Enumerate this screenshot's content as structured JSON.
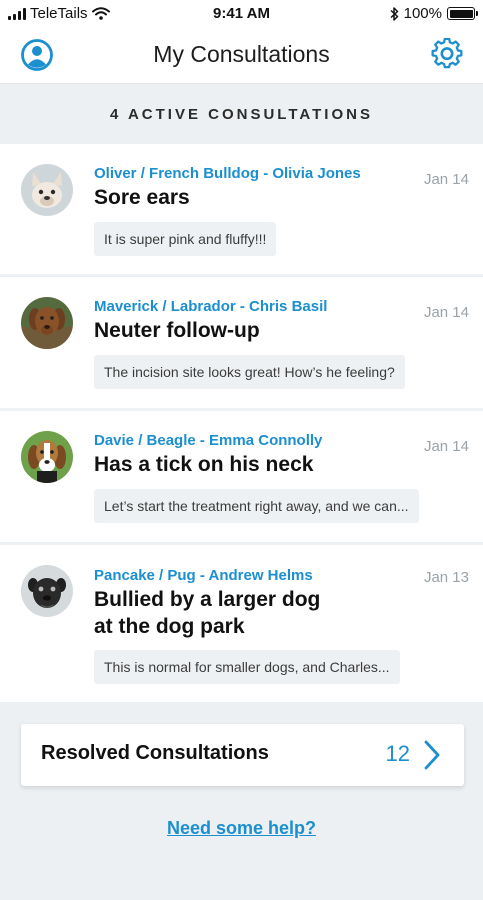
{
  "status_bar": {
    "carrier": "TeleTails",
    "time": "9:41 AM",
    "battery": "100%",
    "battery_level": 1.0
  },
  "header": {
    "title": "My Consultations",
    "left_icon": "profile-icon",
    "right_icon": "gear-icon"
  },
  "section": {
    "title": "4 ACTIVE CONSULTATIONS"
  },
  "consultations": [
    {
      "pet_line": "Oliver / French Bulldog - Olivia Jones",
      "subject": "Sore ears",
      "date": "Jan 14",
      "preview": "It is super pink and fluffy!!!",
      "avatar": "french-bulldog"
    },
    {
      "pet_line": "Maverick / Labrador - Chris Basil",
      "subject": "Neuter follow-up",
      "date": "Jan 14",
      "preview": "The incision site looks great! How’s he feeling?",
      "avatar": "labrador"
    },
    {
      "pet_line": "Davie / Beagle - Emma Connolly",
      "subject": "Has a tick on his neck",
      "date": "Jan 14",
      "preview": "Let’s start the treatment right away, and we can...",
      "avatar": "beagle"
    },
    {
      "pet_line": "Pancake / Pug - Andrew Helms",
      "subject": "Bullied by a larger dog at the dog park",
      "date": "Jan 13",
      "preview": "This is normal for smaller dogs, and Charles...",
      "avatar": "pug"
    }
  ],
  "resolved": {
    "label": "Resolved Consultations",
    "count": "12"
  },
  "help_link": "Need some help?",
  "colors": {
    "accent": "#1b8fcf",
    "background_gray": "#ecf0f2",
    "text_dark": "#111111",
    "date_gray": "#9aa3a9"
  }
}
